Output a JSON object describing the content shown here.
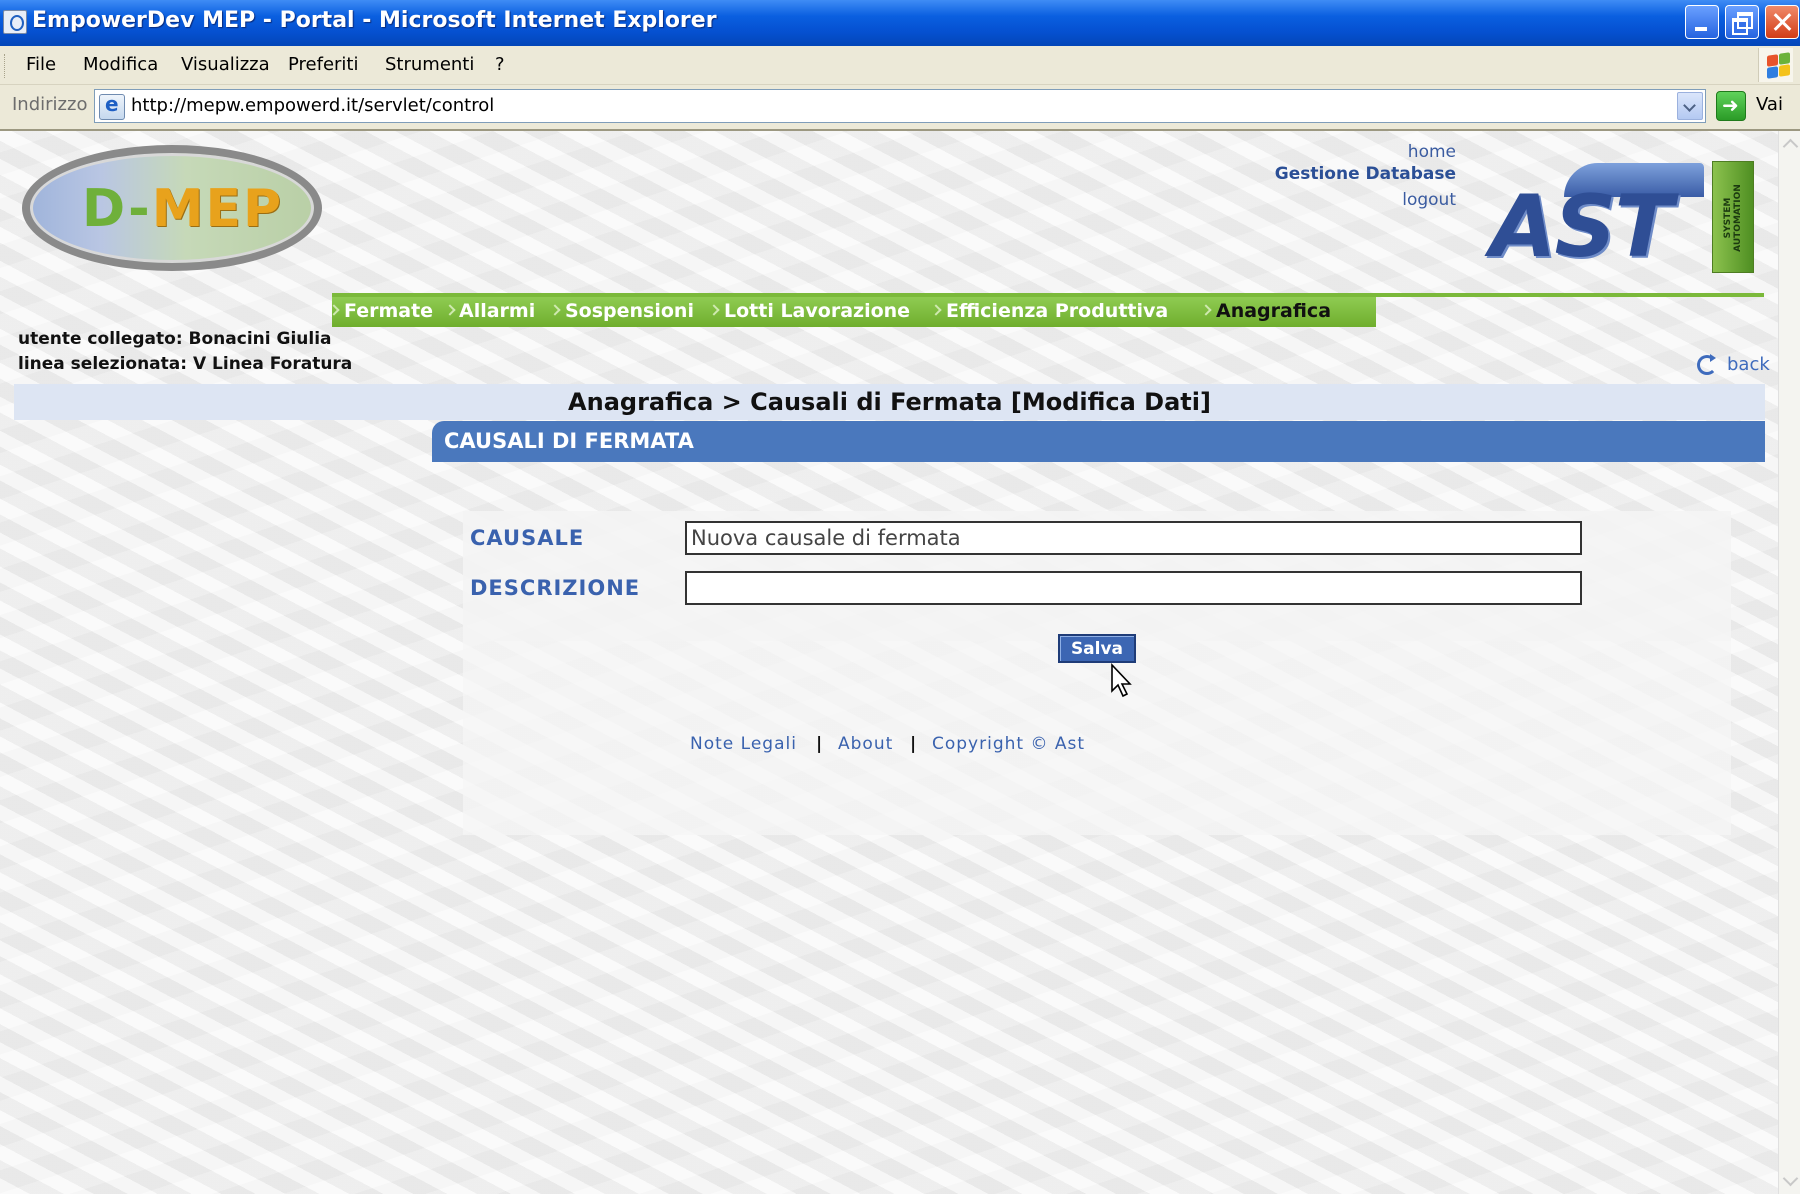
{
  "window": {
    "title": "EmpowerDev MEP - Portal - Microsoft Internet Explorer"
  },
  "menubar": {
    "items": [
      "File",
      "Modifica",
      "Visualizza",
      "Preferiti",
      "Strumenti",
      "?"
    ]
  },
  "addressbar": {
    "label": "Indirizzo",
    "url": "http://mepw.empowerd.it/servlet/control",
    "go_label": "Vai"
  },
  "header": {
    "logo_left": {
      "letter_d": "D-",
      "letters_rest": "MEP"
    },
    "logo_right": {
      "text": "AST",
      "badge": "SYSTEM AUTOMATION"
    },
    "links": {
      "home": "home",
      "database": "Gestione Database",
      "logout": "logout"
    }
  },
  "nav": {
    "items": [
      {
        "label": "Fermate",
        "active": false
      },
      {
        "label": "Allarmi",
        "active": false
      },
      {
        "label": "Sospensioni",
        "active": false
      },
      {
        "label": "Lotti Lavorazione",
        "active": false
      },
      {
        "label": "Efficienza Produttiva",
        "active": false
      },
      {
        "label": "Anagrafica",
        "active": true
      }
    ],
    "accent_color": "#7bb93a"
  },
  "session": {
    "user_line": "utente collegato: Bonacini Giulia",
    "line_line": "linea selezionata: V Linea Foratura"
  },
  "back_label": "back",
  "breadcrumb": "Anagrafica > Causali di Fermata [Modifica Dati]",
  "section": {
    "title": "CAUSALI DI FERMATA",
    "color": "#4a78bd"
  },
  "form": {
    "causale_label": "CAUSALE",
    "causale_value": "Nuova causale di fermata",
    "descrizione_label": "DESCRIZIONE",
    "descrizione_value": "",
    "save_label": "Salva"
  },
  "footer": {
    "legal": "Note Legali",
    "about": "About",
    "copyright": "Copyright © Ast",
    "separator": "|"
  }
}
